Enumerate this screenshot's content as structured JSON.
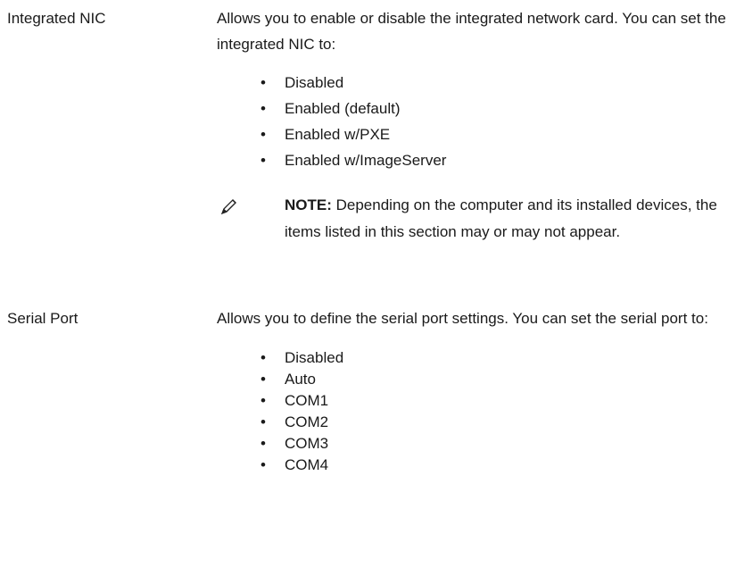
{
  "entries": [
    {
      "term": "Integrated NIC",
      "description": "Allows you to enable or disable the integrated network card. You can set the integrated NIC to:",
      "options": [
        "Disabled",
        "Enabled (default)",
        "Enabled w/PXE",
        "Enabled w/ImageServer"
      ],
      "note": {
        "icon": "pencil-note-icon",
        "label": "NOTE:",
        "text": "Depending on the computer and its installed devices, the items listed in this section may or may not appear."
      }
    },
    {
      "term": "Serial Port",
      "description": "Allows you to define the serial port settings. You can set the serial port to:",
      "options": [
        "Disabled",
        "Auto",
        "COM1",
        "COM2",
        "COM3",
        "COM4"
      ]
    }
  ],
  "bullet_glyph": "•"
}
